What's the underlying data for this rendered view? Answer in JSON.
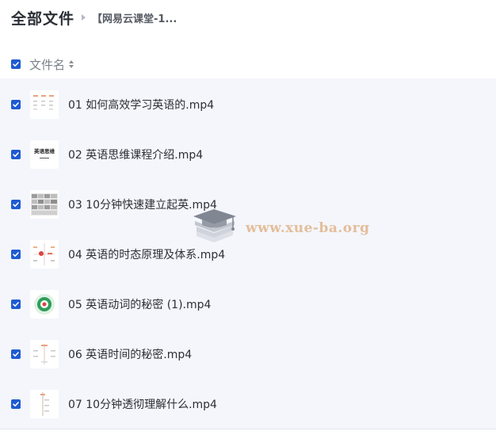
{
  "breadcrumb": {
    "root": "全部文件",
    "current": "【网易云课堂-1..."
  },
  "list_header": {
    "name_column": "文件名"
  },
  "files": [
    {
      "name": "01 如何高效学习英语的.mp4",
      "selected": true
    },
    {
      "name": "02 英语思维课程介绍.mp4",
      "selected": true
    },
    {
      "name": "03 10分钟快速建立起英.mp4",
      "selected": true
    },
    {
      "name": "04 英语的时态原理及体系.mp4",
      "selected": true
    },
    {
      "name": "05 英语动词的秘密 (1).mp4",
      "selected": true
    },
    {
      "name": "06 英语时间的秘密.mp4",
      "selected": true
    },
    {
      "name": "07 10分钟透彻理解什么.mp4",
      "selected": true
    }
  ],
  "thumbnails": {
    "file_02_text": "英语思维"
  },
  "watermark": {
    "text": "www.xue-ba.org"
  },
  "colors": {
    "checkbox": "#1f5bd1",
    "list_background": "#f4f6fb",
    "watermark": "#e2b48a"
  }
}
